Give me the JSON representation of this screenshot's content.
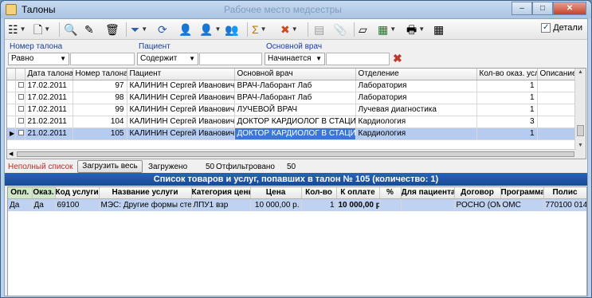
{
  "window": {
    "title": "Талоны",
    "ghost_title": "Рабочее место медсестры",
    "minimize": "–",
    "maximize": "□",
    "close": "✕"
  },
  "toolbar": {
    "details_label": "Детали",
    "details_checked": "✓"
  },
  "filters": {
    "ticket_number": {
      "label": "Номер талона",
      "mode": "Равно",
      "value": ""
    },
    "patient": {
      "label": "Пациент",
      "mode": "Содержит",
      "value": ""
    },
    "main_doctor": {
      "label": "Основной врач",
      "mode": "Начинается",
      "value": ""
    },
    "clear_icon": "✖"
  },
  "tickets": {
    "columns": [
      "Дата талона",
      "Номер талона",
      "Пациент",
      "Основной врач",
      "Отделение",
      "Кол-во оказ. услуг",
      "Описание"
    ],
    "rows": [
      {
        "date": "17.02.2011",
        "number": "97",
        "patient": "КАЛИНИН Сергей Иванович",
        "doctor": "ВРАЧ-Лаборант Лаб",
        "department": "Лаборатория",
        "count": "1",
        "desc": ""
      },
      {
        "date": "17.02.2011",
        "number": "98",
        "patient": "КАЛИНИН Сергей Иванович",
        "doctor": "ВРАЧ-Лаборант Лаб",
        "department": "Лаборатория",
        "count": "1",
        "desc": ""
      },
      {
        "date": "17.02.2011",
        "number": "99",
        "patient": "КАЛИНИН Сергей Иванович",
        "doctor": "ЛУЧЕВОЙ ВРАЧ",
        "department": "Лучевая диагностика",
        "count": "1",
        "desc": ""
      },
      {
        "date": "21.02.2011",
        "number": "104",
        "patient": "КАЛИНИН Сергей Иванович",
        "doctor": "ДОКТОР КАРДИОЛОГ В СТАЦИОНАРЕ",
        "department": "Кардиология",
        "count": "3",
        "desc": ""
      },
      {
        "date": "21.02.2011",
        "number": "105",
        "patient": "КАЛИНИН Сергей Иванович",
        "doctor": "ДОКТОР КАРДИОЛОГ В СТАЦИОНАРЕ",
        "department": "Кардиология",
        "count": "1",
        "desc": ""
      }
    ]
  },
  "status": {
    "partial_list": "Неполный список",
    "load_all": "Загрузить весь",
    "loaded_label": "Загружено",
    "loaded_value": "50",
    "filtered_label": "Отфильтровано",
    "filtered_value": "50"
  },
  "services": {
    "title": "Список товаров и услуг, попавших в талон № 105 (количество: 1)",
    "columns": [
      "Опл.",
      "Оказ.",
      "Код услуги",
      "Название услуги",
      "Категория цены",
      "Цена",
      "Кол-во",
      "К оплате",
      "%",
      "Для пациента",
      "Договор",
      "Программа",
      "Полис"
    ],
    "rows": [
      {
        "paid": "Да",
        "done": "Да",
        "code": "69100",
        "name": "МЭС: Другие формы стенокардии",
        "category": "ЛПУ1 взр",
        "price": "10 000,00 р.",
        "qty": "1",
        "to_pay": "10 000,00 р.",
        "percent": "",
        "for_patient": "",
        "contract": "РОСНО (ОМС)",
        "program": "ОМС",
        "policy": "770100 01440404"
      }
    ]
  }
}
